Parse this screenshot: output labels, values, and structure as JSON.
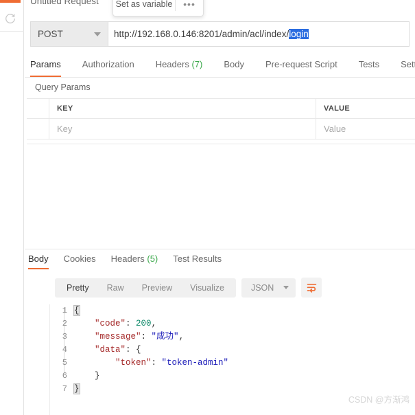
{
  "sidebar": {
    "refresh_icon": "refresh-icon",
    "accent_color": "#ef6c33"
  },
  "request": {
    "title": "Untitled Request",
    "method": "POST",
    "method_caret_icon": "chevron-down-icon",
    "url_prefix": "http://192.168.0.146:8201/admin/acl/index/",
    "url_selected": "login",
    "url_full": "http://192.168.0.146:8201/admin/acl/index/login",
    "selection_color": "#2a6ce0"
  },
  "popup": {
    "label": "Set as variable",
    "more_label": "•••"
  },
  "request_tabs": [
    {
      "label": "Params",
      "count": "",
      "active": true
    },
    {
      "label": "Authorization",
      "count": "",
      "active": false
    },
    {
      "label": "Headers",
      "count": "(7)",
      "active": false
    },
    {
      "label": "Body",
      "count": "",
      "active": false
    },
    {
      "label": "Pre-request Script",
      "count": "",
      "active": false
    },
    {
      "label": "Tests",
      "count": "",
      "active": false
    },
    {
      "label": "Settin",
      "count": "",
      "active": false
    }
  ],
  "query_params": {
    "section_label": "Query Params",
    "columns": [
      "KEY",
      "VALUE"
    ],
    "rows": [
      {
        "key_placeholder": "Key",
        "value_placeholder": "Value"
      }
    ]
  },
  "response_tabs": [
    {
      "label": "Body",
      "count": "",
      "active": true
    },
    {
      "label": "Cookies",
      "count": "",
      "active": false
    },
    {
      "label": "Headers",
      "count": "(5)",
      "active": false
    },
    {
      "label": "Test Results",
      "count": "",
      "active": false
    }
  ],
  "viewer": {
    "formats": [
      {
        "label": "Pretty",
        "active": true
      },
      {
        "label": "Raw",
        "active": false
      },
      {
        "label": "Preview",
        "active": false
      },
      {
        "label": "Visualize",
        "active": false
      }
    ],
    "language": "JSON",
    "language_caret_icon": "chevron-down-icon",
    "wrap_icon": "word-wrap-icon",
    "wrap_icon_color": "#ef6c33"
  },
  "response_body": {
    "language": "json",
    "line_numbers": [
      "1",
      "2",
      "3",
      "4",
      "5",
      "6",
      "7"
    ],
    "lines": [
      "{",
      "    \"code\": 200,",
      "    \"message\": \"成功\",",
      "    \"data\": {",
      "        \"token\": \"token-admin\"",
      "    }",
      "}"
    ],
    "parsed": {
      "code": 200,
      "message": "成功",
      "data": {
        "token": "token-admin"
      }
    },
    "syntax_colors": {
      "key": "#a52a2a",
      "string": "#1a1ab8",
      "number": "#0f8a6a",
      "punctuation": "#333333"
    }
  },
  "watermark": {
    "text": "CSDN @方渐鸿"
  }
}
